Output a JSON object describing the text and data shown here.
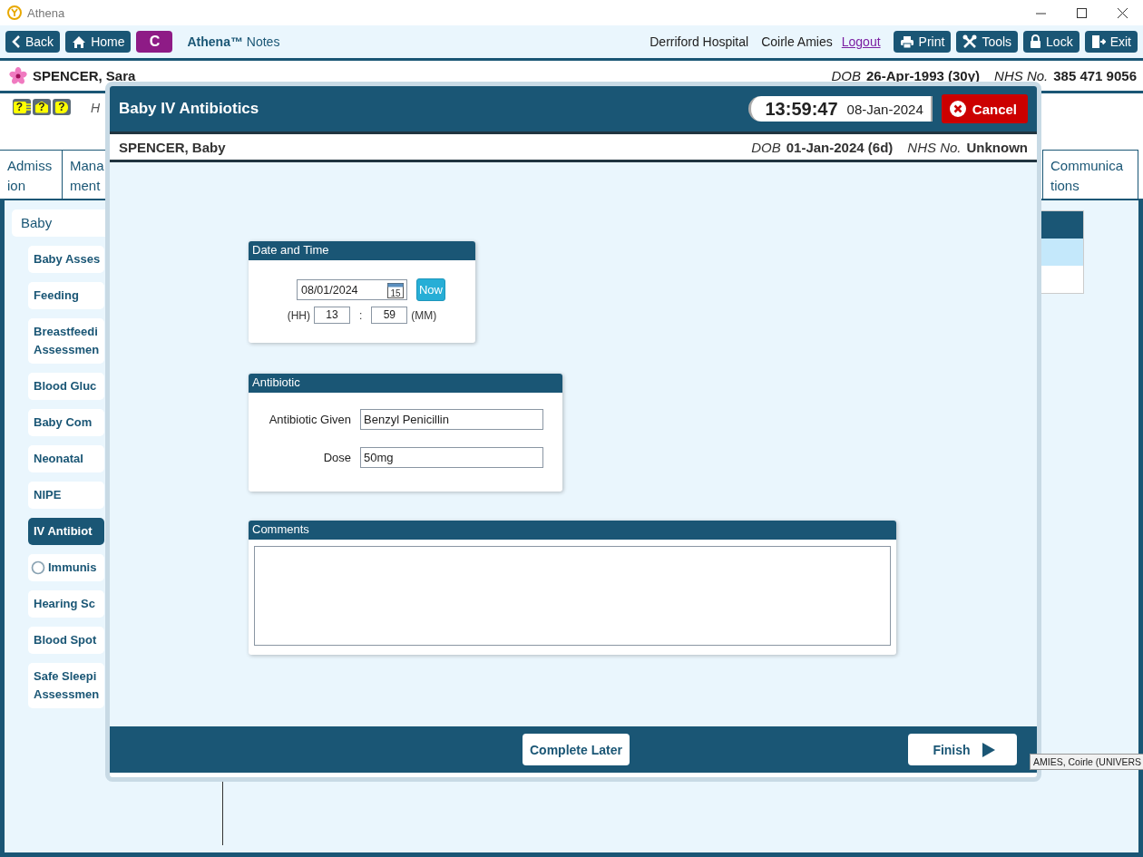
{
  "app": {
    "title": "Athena"
  },
  "toolbar": {
    "left_buttons": [
      {
        "label": "Back",
        "kind": "back"
      },
      {
        "label": "Home",
        "kind": "home"
      },
      {
        "label": "C",
        "kind": "letter"
      }
    ],
    "app_name": "**Athena™** Notes",
    "hospital": "Derriford Hospital",
    "user": "Coirle Amies",
    "logout": "Logout",
    "right_buttons": [
      {
        "label": "Print",
        "kind": "print"
      },
      {
        "label": "Tools",
        "kind": "tools"
      },
      {
        "label": "Lock",
        "kind": "lock"
      },
      {
        "label": "Exit",
        "kind": "exit"
      }
    ]
  },
  "patient": {
    "name": "SPENCER, Sara",
    "dob_label": "DOB",
    "dob": "26-Apr-1993 (30y)",
    "nhs_label": "NHS No.",
    "nhs": "385 471 9056"
  },
  "alerts": {
    "icons": [
      {
        "glyph": "?",
        "kind": "list"
      },
      {
        "glyph": "?",
        "kind": "house"
      },
      {
        "glyph": "?",
        "kind": "plain"
      }
    ],
    "note": "H"
  },
  "tabs": [
    {
      "lines": [
        "Admiss",
        "ion"
      ]
    },
    {
      "lines": [
        "Mana",
        "ment"
      ]
    },
    {
      "lines": [
        "Communica",
        "tions"
      ]
    }
  ],
  "sidebar": {
    "items": [
      {
        "label": "Baby",
        "selected": false,
        "children": [
          {
            "lines": [
              "Baby Asses"
            ],
            "kind": "plain",
            "selected": false
          },
          {
            "lines": [
              "Feeding"
            ],
            "kind": "plain",
            "selected": false
          },
          {
            "lines": [
              "Breastfeedi",
              "Assessmen"
            ],
            "kind": "plain",
            "selected": false
          },
          {
            "lines": [
              "Blood Gluc"
            ],
            "kind": "plain",
            "selected": false
          },
          {
            "lines": [
              "Baby Com"
            ],
            "kind": "plain",
            "selected": false
          },
          {
            "lines": [
              "Neonatal"
            ],
            "kind": "plain",
            "selected": false
          },
          {
            "lines": [
              "NIPE"
            ],
            "kind": "plain",
            "selected": false
          },
          {
            "lines": [
              "IV Antibiot"
            ],
            "kind": "plain",
            "selected": true
          },
          {
            "lines": [
              "Immunis"
            ],
            "kind": "status",
            "selected": false
          },
          {
            "lines": [
              "Hearing Sc"
            ],
            "kind": "plain",
            "selected": false
          },
          {
            "lines": [
              "Blood Spot"
            ],
            "kind": "plain",
            "selected": false
          },
          {
            "lines": [
              "Safe Sleepi",
              "Assessmen"
            ],
            "kind": "plain",
            "selected": false
          }
        ]
      }
    ]
  },
  "side_table": {
    "rows": [
      {
        "selected": false,
        "kind": "header"
      },
      {
        "selected": true,
        "kind": "row"
      },
      {
        "selected": false,
        "kind": "row"
      }
    ]
  },
  "modal": {
    "title": "Baby IV Antibiotics",
    "time": "13:59:47",
    "date": "08-Jan-2024",
    "cancel": "Cancel",
    "baby": {
      "name": "SPENCER, Baby",
      "dob_label": "DOB",
      "dob": "01-Jan-2024 (6d)",
      "nhs_label": "NHS No.",
      "nhs": "Unknown"
    },
    "date_time": {
      "title": "Date and Time",
      "date": "08/01/2024",
      "calendar_day": "15",
      "now": "Now",
      "hh_label": "(HH)",
      "hh": "13",
      "separator": ":",
      "mm": "59",
      "mm_label": "(MM)"
    },
    "antibiotic": {
      "title": "Antibiotic",
      "fields": [
        {
          "label": "Antibiotic Given",
          "value": "Benzyl Penicillin"
        },
        {
          "label": "Dose",
          "value": "50mg"
        }
      ]
    },
    "comments": {
      "title": "Comments"
    },
    "footer": {
      "complete_later": "Complete Later",
      "finish": "Finish"
    }
  },
  "tooltip": "AMIES, Coirle (UNIVERS"
}
